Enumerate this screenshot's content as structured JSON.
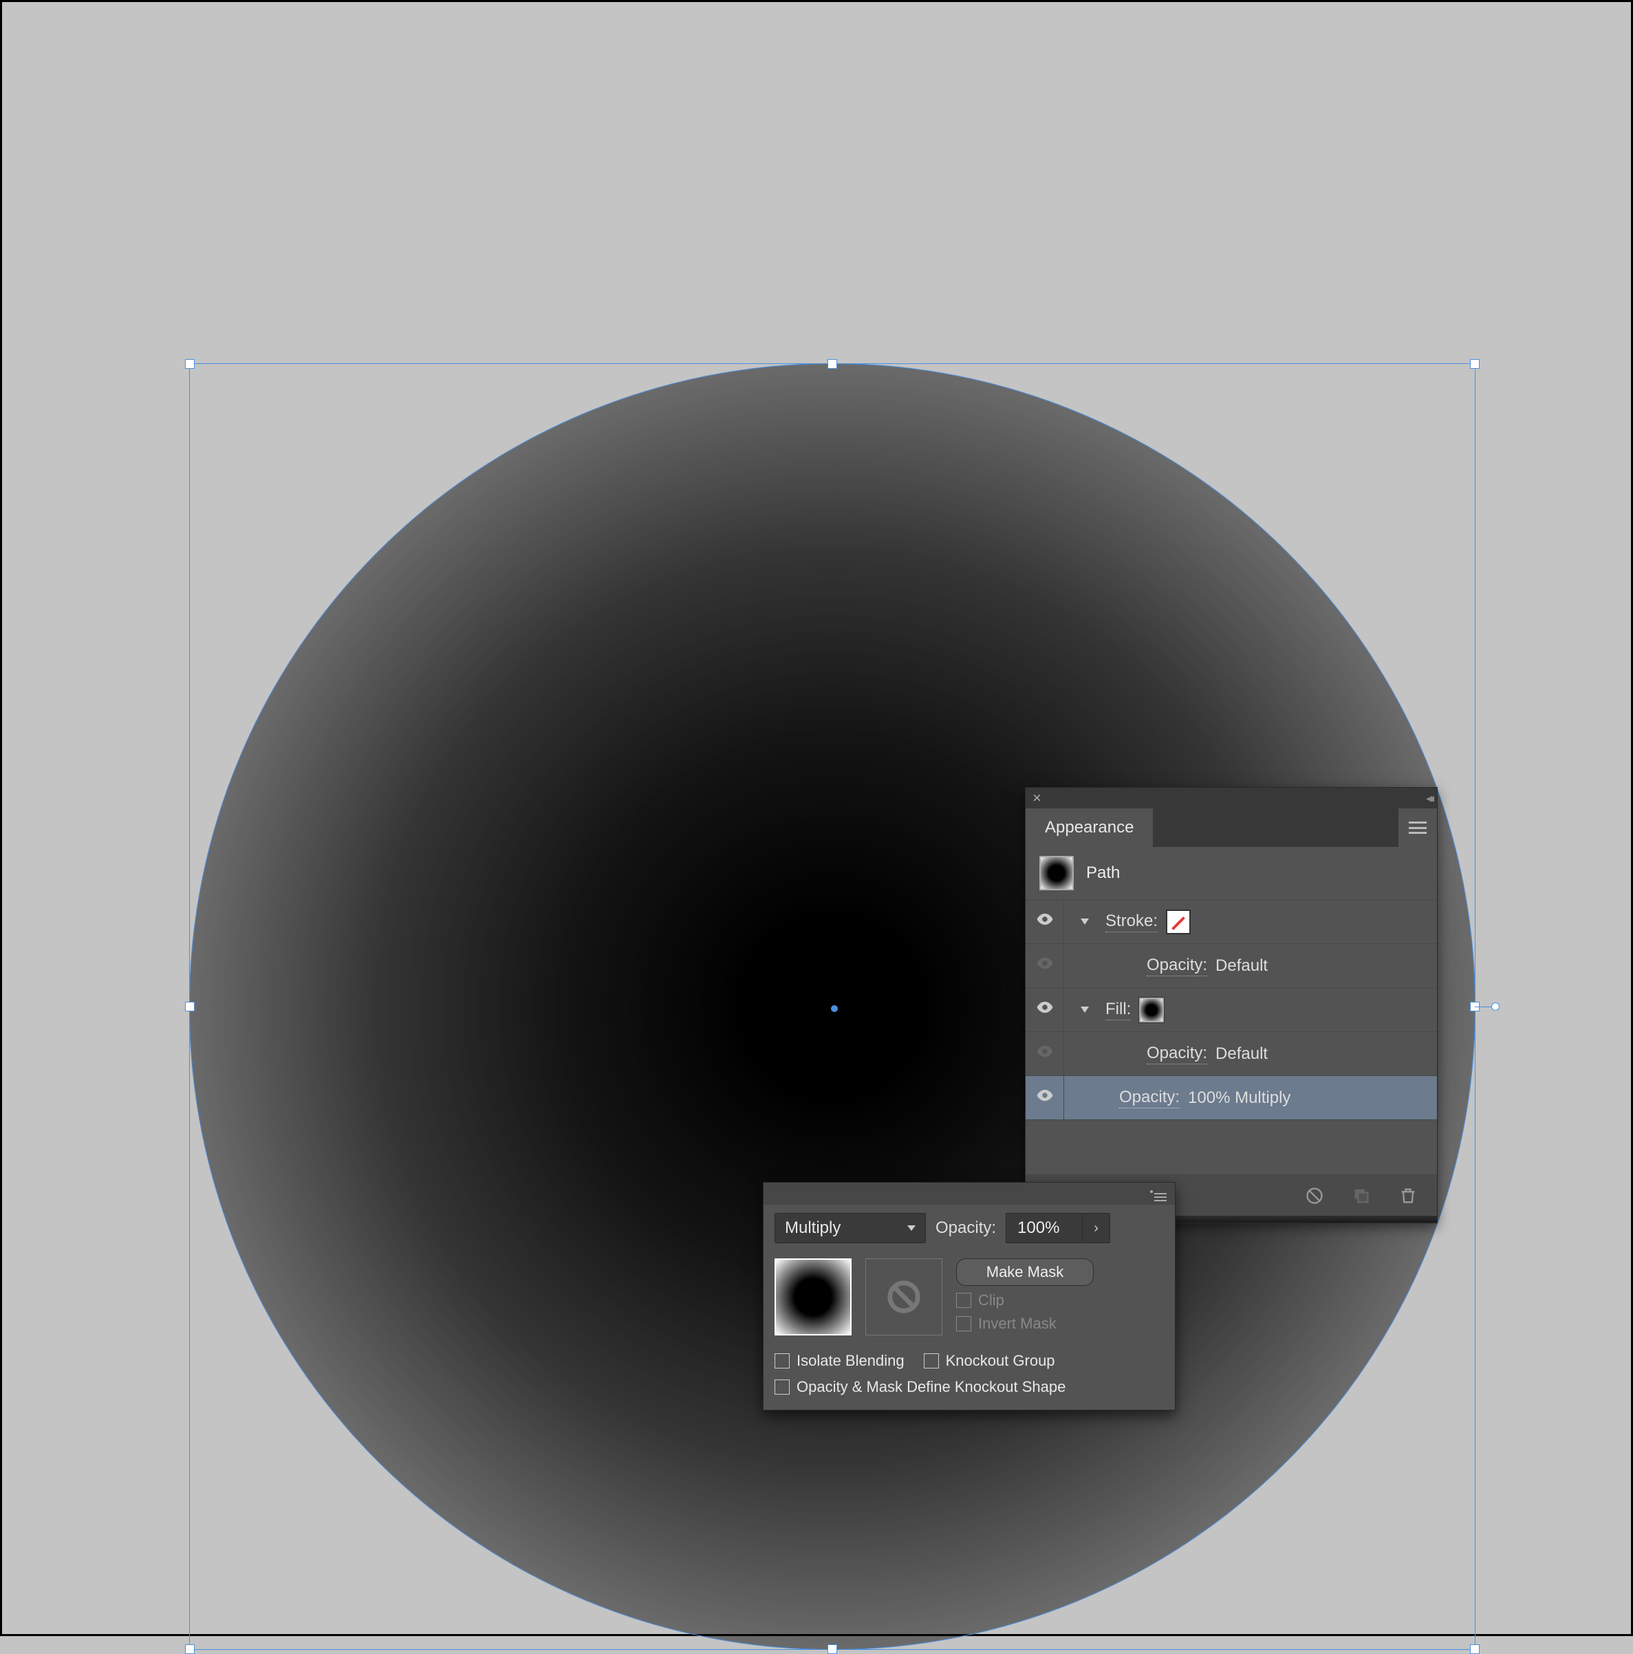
{
  "appearance_panel": {
    "tab_label": "Appearance",
    "path_label": "Path",
    "rows": {
      "stroke": {
        "label": "Stroke:"
      },
      "stroke_opacity": {
        "label": "Opacity:",
        "value": "Default"
      },
      "fill": {
        "label": "Fill:"
      },
      "fill_opacity": {
        "label": "Opacity:",
        "value": "Default"
      },
      "object_opacity": {
        "label": "Opacity:",
        "value": "100% Multiply"
      }
    }
  },
  "transparency_panel": {
    "blend_mode": "Multiply",
    "opacity_label": "Opacity:",
    "opacity_value": "100%",
    "make_mask_label": "Make Mask",
    "clip_label": "Clip",
    "invert_mask_label": "Invert Mask",
    "isolate_blending_label": "Isolate Blending",
    "knockout_group_label": "Knockout Group",
    "define_shape_label": "Opacity & Mask Define Knockout Shape"
  }
}
